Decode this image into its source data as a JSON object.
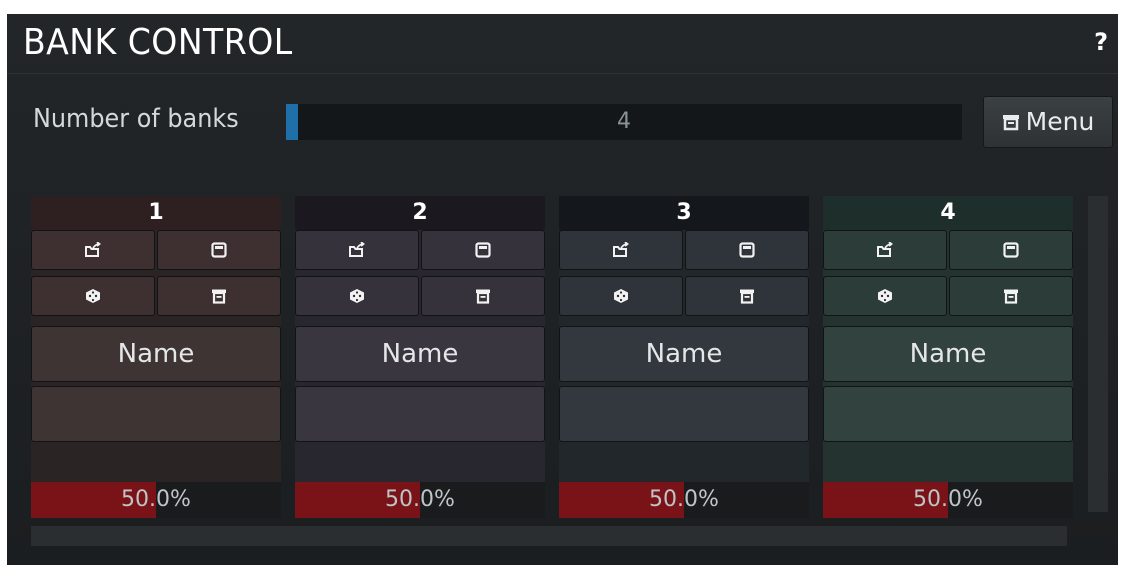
{
  "header": {
    "title": "BANK CONTROL",
    "help": "?"
  },
  "number_of_banks": {
    "label": "Number of banks",
    "value": "4"
  },
  "menu": {
    "label": "Menu",
    "icon": "menu-icon"
  },
  "banks": [
    {
      "number": "1",
      "name": "Name",
      "percent": "50.0%",
      "level": 0.5,
      "colors": {
        "head": "#2e2020",
        "bg": "#2a2424",
        "btn": "#3e3030",
        "name": "#3e3434"
      }
    },
    {
      "number": "2",
      "name": "Name",
      "percent": "50.0%",
      "level": 0.5,
      "colors": {
        "head": "#1b1820",
        "bg": "#28262e",
        "btn": "#36323c",
        "name": "#3a3640"
      }
    },
    {
      "number": "3",
      "name": "Name",
      "percent": "50.0%",
      "level": 0.5,
      "colors": {
        "head": "#14181c",
        "bg": "#22272c",
        "btn": "#2e343a",
        "name": "#32383e"
      }
    },
    {
      "number": "4",
      "name": "Name",
      "percent": "50.0%",
      "level": 0.5,
      "colors": {
        "head": "#1e2e2a",
        "bg": "#243230",
        "btn": "#2c3c38",
        "name": "#32423e"
      }
    }
  ],
  "bank_icons": [
    "load-icon",
    "save-icon",
    "randomize-icon",
    "menu-icon"
  ]
}
